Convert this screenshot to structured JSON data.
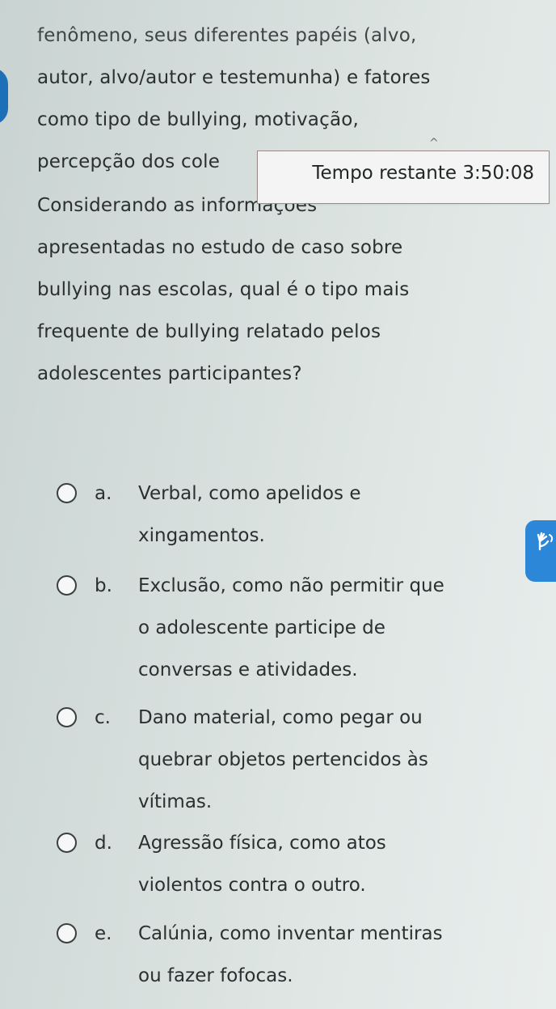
{
  "context": {
    "lines": [
      "fenômeno, seus diferentes papéis (alvo,",
      "autor, alvo/autor e testemunha) e fatores",
      "como tipo de bullying, motivação,",
      "percepção dos cole"
    ]
  },
  "timer": {
    "label": "Tempo restante",
    "value": "3:50:08"
  },
  "question": {
    "lines": [
      "Considerando as informações",
      "apresentadas no estudo de caso sobre",
      "bullying nas escolas, qual é o tipo mais",
      "frequente de bullying relatado pelos",
      "adolescentes participantes?"
    ]
  },
  "options": [
    {
      "letter": "a.",
      "lines": [
        "Verbal, como apelidos e",
        "xingamentos."
      ]
    },
    {
      "letter": "b.",
      "lines": [
        "Exclusão, como não permitir que",
        "o adolescente participe de",
        "conversas e atividades."
      ]
    },
    {
      "letter": "c.",
      "lines": [
        "Dano material, como pegar ou",
        "quebrar objetos pertencidos às",
        "vítimas."
      ]
    },
    {
      "letter": "d.",
      "lines": [
        "Agressão física, como atos",
        "violentos contra o outro."
      ]
    },
    {
      "letter": "e.",
      "lines": [
        "Calúnia, como inventar mentiras",
        "ou fazer fofocas."
      ]
    }
  ],
  "icons": {
    "left_tab": "side-panel-tab",
    "right_tab": "accessibility-hand-icon"
  },
  "colors": {
    "accent": "#2d87d8",
    "left_tab": "#1d6fb8"
  }
}
